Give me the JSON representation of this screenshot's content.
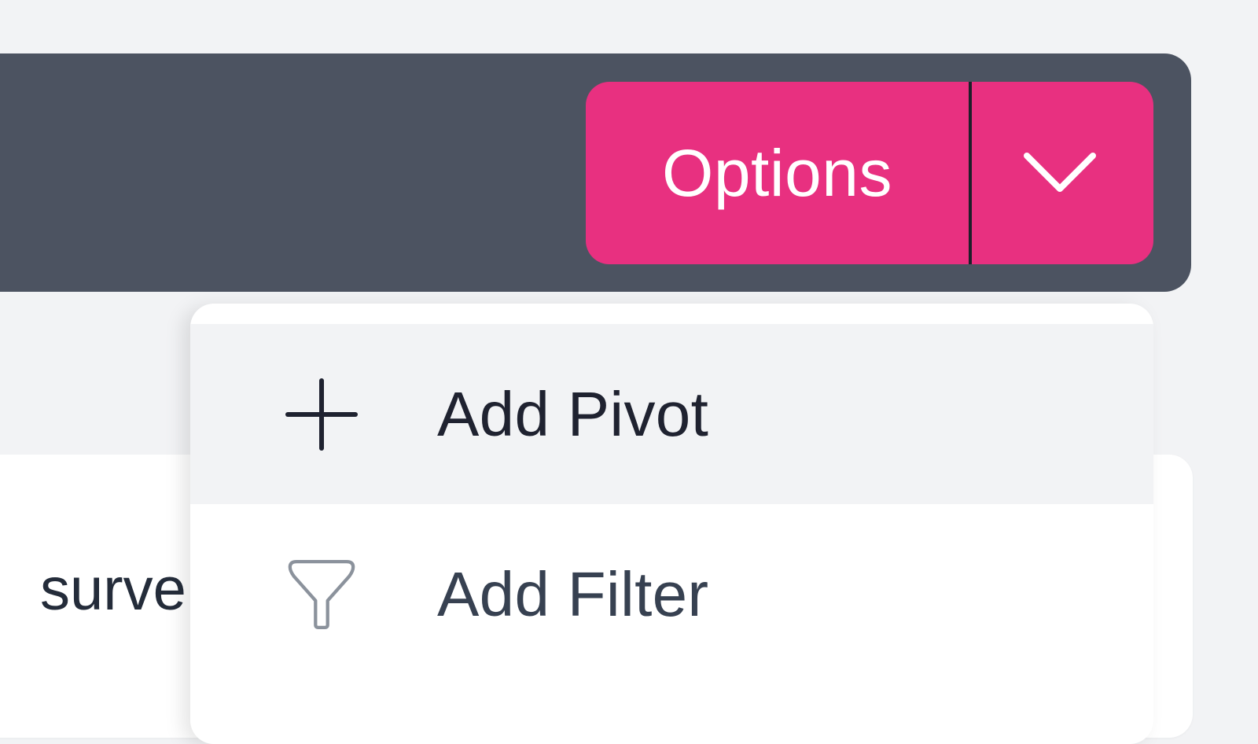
{
  "toolbar": {
    "options_button": {
      "label": "Options",
      "accent_color": "#e83080"
    },
    "dropdown_toggle_icon": "chevron-down-icon"
  },
  "card": {
    "partial_text": "surve"
  },
  "dropdown": {
    "items": [
      {
        "label": "Add Pivot",
        "icon": "plus-icon",
        "highlighted": true
      },
      {
        "label": "Add Filter",
        "icon": "filter-icon",
        "highlighted": false
      }
    ]
  },
  "colors": {
    "toolbar_bg": "#4c5361",
    "page_bg": "#f2f3f5",
    "accent": "#e83080",
    "text_dark": "#1f2230"
  }
}
